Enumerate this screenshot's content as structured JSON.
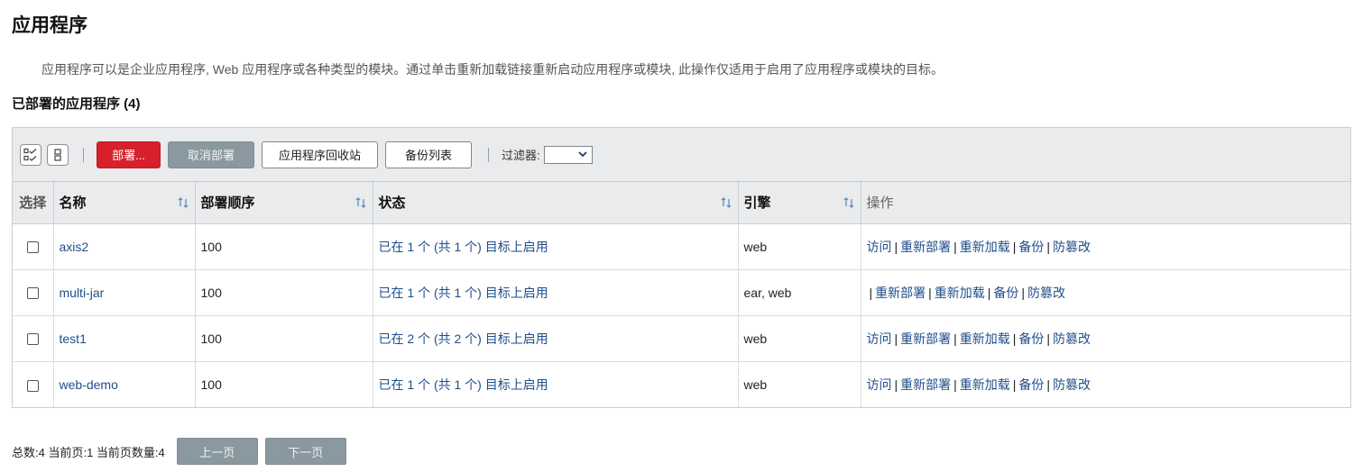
{
  "page": {
    "title": "应用程序",
    "description": "应用程序可以是企业应用程序, Web 应用程序或各种类型的模块。通过单击重新加载链接重新启动应用程序或模块, 此操作仅适用于启用了应用程序或模块的目标。",
    "section_title": "已部署的应用程序 (4)"
  },
  "toolbar": {
    "select_all_icon": "select-all-icon",
    "deselect_all_icon": "deselect-all-icon",
    "deploy_label": "部署...",
    "undeploy_label": "取消部署",
    "recycle_label": "应用程序回收站",
    "backup_list_label": "备份列表",
    "filter_label": "过滤器:",
    "filter_value": ""
  },
  "table": {
    "headers": {
      "select": "选择",
      "name": "名称",
      "order": "部署顺序",
      "status": "状态",
      "engine": "引擎",
      "ops": "操作"
    },
    "rows": [
      {
        "name": "axis2",
        "order": "100",
        "status": "已在 1 个 (共 1 个) 目标上启用",
        "engine": "web",
        "ops": {
          "visit": "访问",
          "redeploy": "重新部署",
          "reload": "重新加载",
          "backup": "备份",
          "tamper": "防篡改"
        }
      },
      {
        "name": "multi-jar",
        "order": "100",
        "status": "已在 1 个 (共 1 个) 目标上启用",
        "engine": "ear, web",
        "ops": {
          "visit": "",
          "redeploy": "重新部署",
          "reload": "重新加载",
          "backup": "备份",
          "tamper": "防篡改"
        }
      },
      {
        "name": "test1",
        "order": "100",
        "status": "已在 2 个 (共 2 个) 目标上启用",
        "engine": "web",
        "ops": {
          "visit": "访问",
          "redeploy": "重新部署",
          "reload": "重新加载",
          "backup": "备份",
          "tamper": "防篡改"
        }
      },
      {
        "name": "web-demo",
        "order": "100",
        "status": "已在 1 个 (共 1 个) 目标上启用",
        "engine": "web",
        "ops": {
          "visit": "访问",
          "redeploy": "重新部署",
          "reload": "重新加载",
          "backup": "备份",
          "tamper": "防篡改"
        }
      }
    ]
  },
  "pagination": {
    "summary": "总数:4 当前页:1 当前页数量:4",
    "prev_label": "上一页",
    "next_label": "下一页"
  },
  "colors": {
    "primary_button": "#d7202b",
    "disabled_button": "#8a989f",
    "link": "#1f4e8a",
    "header_bg": "#e9ebed"
  }
}
